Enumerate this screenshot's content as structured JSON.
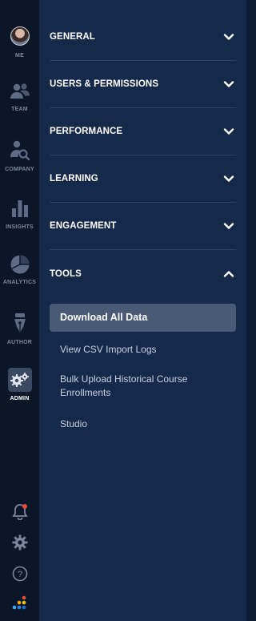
{
  "rail": {
    "items": [
      {
        "label": "ME",
        "icon": "avatar"
      },
      {
        "label": "TEAM",
        "icon": "team-icon"
      },
      {
        "label": "COMPANY",
        "icon": "company-search-icon"
      },
      {
        "label": "INSIGHTS",
        "icon": "bar-chart-icon"
      },
      {
        "label": "ANALYTICS",
        "icon": "pie-chart-icon"
      },
      {
        "label": "AUTHOR",
        "icon": "pen-nib-icon"
      },
      {
        "label": "ADMIN",
        "icon": "gears-icon"
      }
    ],
    "bottom": [
      {
        "icon": "bell-icon",
        "has_notification": true
      },
      {
        "icon": "gear-icon"
      },
      {
        "icon": "help-icon",
        "text": "?"
      },
      {
        "icon": "logo-dots-icon"
      }
    ]
  },
  "sections": [
    {
      "title": "GENERAL",
      "expanded": false
    },
    {
      "title": "USERS & PERMISSIONS",
      "expanded": false
    },
    {
      "title": "PERFORMANCE",
      "expanded": false
    },
    {
      "title": "LEARNING",
      "expanded": false
    },
    {
      "title": "ENGAGEMENT",
      "expanded": false
    },
    {
      "title": "TOOLS",
      "expanded": true
    }
  ],
  "tools_items": [
    {
      "label": "Download All Data",
      "selected": true
    },
    {
      "label": "View CSV Import Logs",
      "selected": false
    },
    {
      "label": "Bulk Upload Historical Course Enrollments",
      "selected": false
    },
    {
      "label": "Studio",
      "selected": false
    }
  ],
  "colors": {
    "rail_bg": "#0b1729",
    "panel_bg": "#15294a",
    "selected_bg": "#485a74",
    "notification": "#e64a3c"
  }
}
